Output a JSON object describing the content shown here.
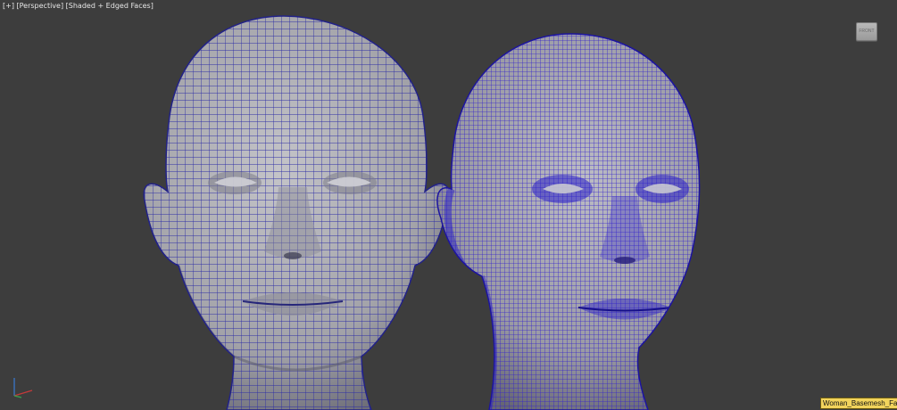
{
  "viewport": {
    "label_open": "[",
    "label_plus": "+",
    "label_close_open": "] [",
    "label_view": "Perspective",
    "label_mid": "] [",
    "label_shading": "Shaded + Edged Faces",
    "label_end": "]"
  },
  "viewcube": {
    "face": "FRONT",
    "icon": "viewcube-icon"
  },
  "axis": {
    "icon": "axis-tripod-icon"
  },
  "selected_object": {
    "name": "Woman_Basemesh_Face"
  },
  "colors": {
    "background": "#3d3d3d",
    "mesh_surface": "#a6a6aa",
    "wire_low": "#2a2a9a",
    "wire_high": "#2b1fd0",
    "tooltip_bg": "#f2d45c"
  }
}
